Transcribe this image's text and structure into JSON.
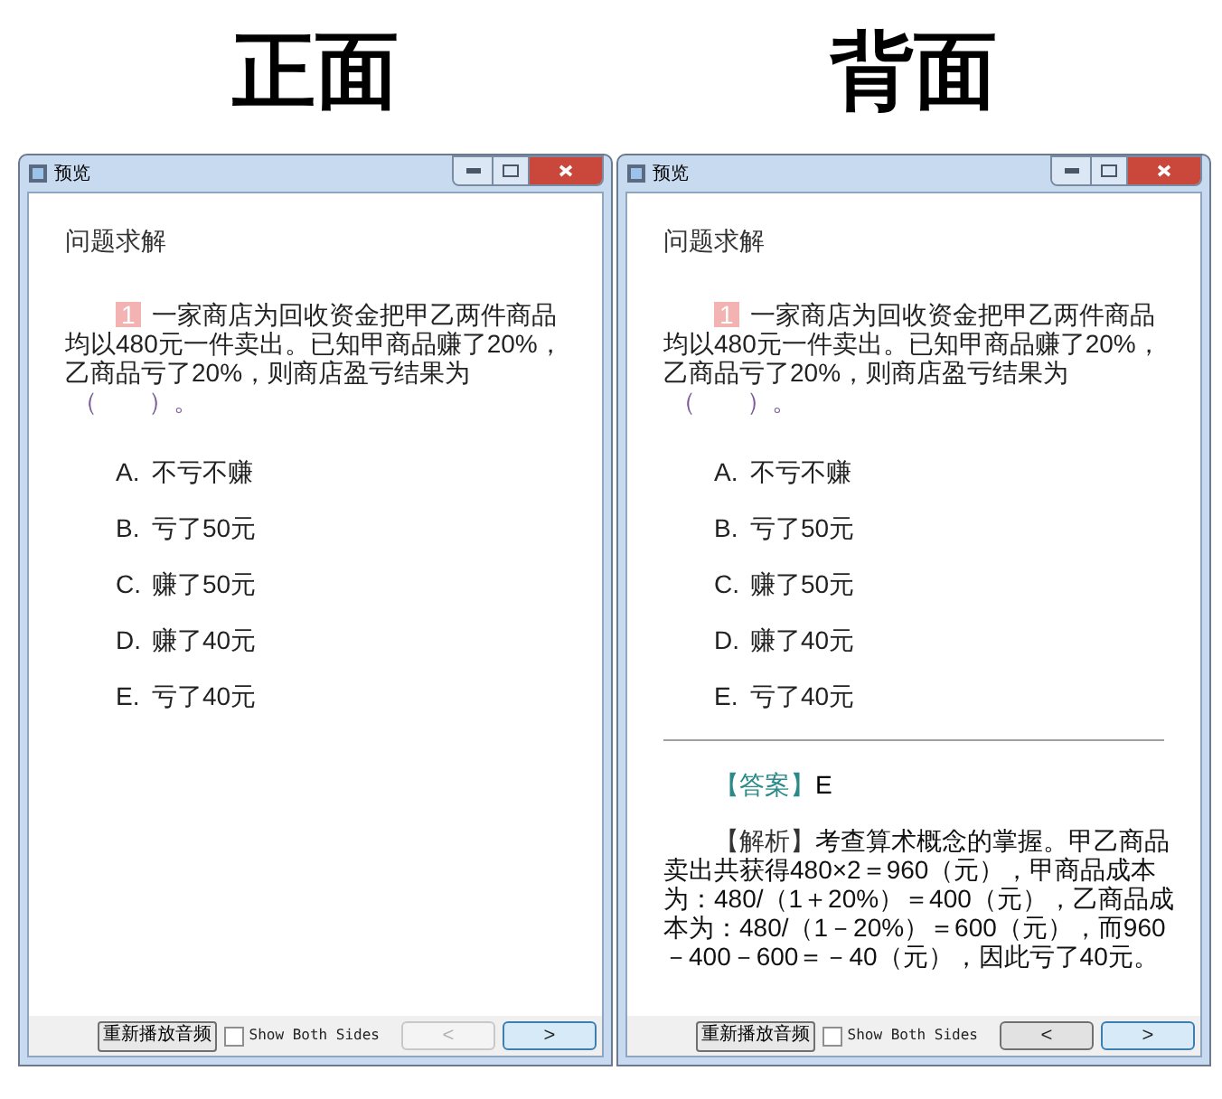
{
  "panels": [
    {
      "heading": "正面",
      "window": {
        "title": "预览"
      },
      "section_title": "问题求解",
      "question": {
        "number": "1",
        "text": "一家商店为回收资金把甲乙两件商品均以480元一件卖出。已知甲商品赚了20%，乙商品亏了20%，则商店盈亏结果为",
        "blank": "（　　）。"
      },
      "options": [
        {
          "letter": "A.",
          "text": "不亏不赚"
        },
        {
          "letter": "B.",
          "text": "亏了50元"
        },
        {
          "letter": "C.",
          "text": "赚了50元"
        },
        {
          "letter": "D.",
          "text": "赚了40元"
        },
        {
          "letter": "E.",
          "text": "亏了40元"
        }
      ],
      "footer": {
        "replay_button": "重新播放音频",
        "show_both_sides": {
          "label": "Show Both Sides",
          "checked": false
        },
        "prev_button": {
          "label": "<",
          "disabled": true
        },
        "next_button": {
          "label": ">",
          "disabled": false
        }
      }
    },
    {
      "heading": "背面",
      "window": {
        "title": "预览"
      },
      "section_title": "问题求解",
      "question": {
        "number": "1",
        "text": "一家商店为回收资金把甲乙两件商品均以480元一件卖出。已知甲商品赚了20%，乙商品亏了20%，则商店盈亏结果为",
        "blank": "（　　）。"
      },
      "options": [
        {
          "letter": "A.",
          "text": "不亏不赚"
        },
        {
          "letter": "B.",
          "text": "亏了50元"
        },
        {
          "letter": "C.",
          "text": "赚了50元"
        },
        {
          "letter": "D.",
          "text": "赚了40元"
        },
        {
          "letter": "E.",
          "text": "亏了40元"
        }
      ],
      "answer": {
        "label": "【答案】",
        "value": "E"
      },
      "explanation": {
        "label": "【解析】",
        "text": "考查算术概念的掌握。甲乙商品卖出共获得480×2＝960（元），甲商品成本为：480/（1＋20%）＝400（元），乙商品成本为：480/（1－20%）＝600（元），而960－400－600＝－40（元），因此亏了40元。"
      },
      "footer": {
        "replay_button": "重新播放音频",
        "show_both_sides": {
          "label": "Show Both Sides",
          "checked": false
        },
        "prev_button": {
          "label": "<",
          "disabled": false
        },
        "next_button": {
          "label": ">",
          "disabled": false
        }
      }
    }
  ]
}
